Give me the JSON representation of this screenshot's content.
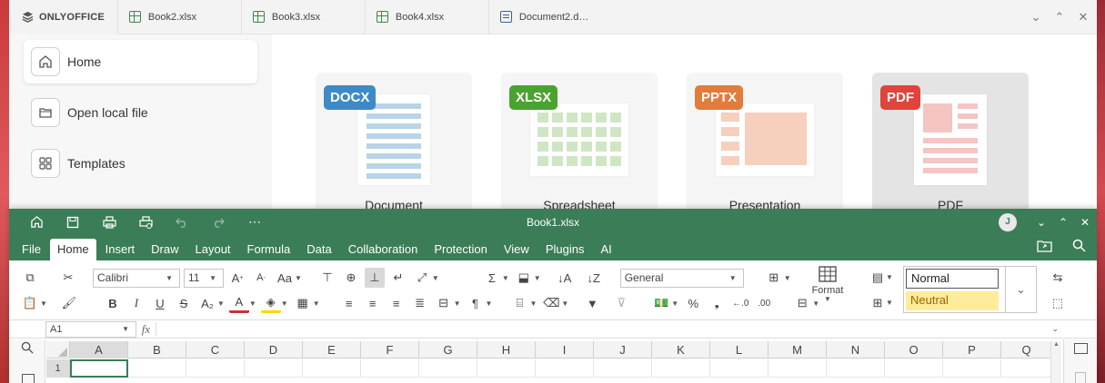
{
  "start": {
    "logo": "ONLYOFFICE",
    "tabs": [
      {
        "label": "Book2.xlsx",
        "kind": "xlsx"
      },
      {
        "label": "Book3.xlsx",
        "kind": "xlsx"
      },
      {
        "label": "Book4.xlsx",
        "kind": "xlsx"
      },
      {
        "label": "Document2.d…",
        "kind": "docx"
      }
    ],
    "nav": [
      {
        "label": "Home",
        "icon": "home-icon"
      },
      {
        "label": "Open local file",
        "icon": "folder-icon"
      },
      {
        "label": "Templates",
        "icon": "grid-icon"
      }
    ],
    "cards": [
      {
        "badge": "DOCX",
        "label": "Document",
        "color": "#3e8ac7"
      },
      {
        "badge": "XLSX",
        "label": "Spreadsheet",
        "color": "#4aa32f"
      },
      {
        "badge": "PPTX",
        "label": "Presentation",
        "color": "#e37b3a"
      },
      {
        "badge": "PDF",
        "label": "PDF",
        "color": "#e0443c"
      }
    ]
  },
  "editor": {
    "title": "Book1.xlsx",
    "avatar": "J",
    "accent": "#3b7d57",
    "menu": [
      "File",
      "Home",
      "Insert",
      "Draw",
      "Layout",
      "Formula",
      "Data",
      "Collaboration",
      "Protection",
      "View",
      "Plugins",
      "AI"
    ],
    "font_name": "Calibri",
    "font_size": "11",
    "number_format": "General",
    "format_label": "Format",
    "styles": {
      "normal": "Normal",
      "neutral": "Neutral"
    },
    "name_box": "A1",
    "fx": "fx",
    "columns": [
      "A",
      "B",
      "C",
      "D",
      "E",
      "F",
      "G",
      "H",
      "I",
      "J",
      "K",
      "L",
      "M",
      "N",
      "O",
      "P",
      "Q"
    ],
    "first_row": "1"
  }
}
